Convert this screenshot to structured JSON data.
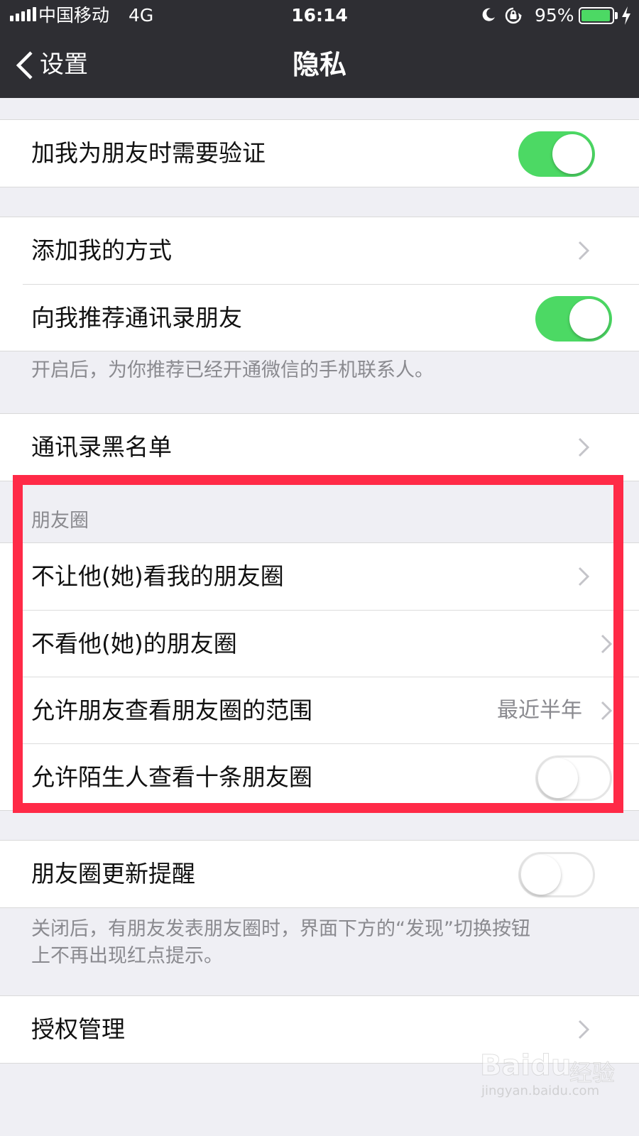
{
  "status_bar": {
    "carrier": "中国移动",
    "network": "4G",
    "time": "16:14",
    "battery_percent": "95%",
    "battery_level": 0.95,
    "battery_color": "#4cd964",
    "icons": [
      "signal-icon",
      "moon-icon",
      "rotation-lock-icon",
      "battery-icon",
      "charging-icon"
    ]
  },
  "nav": {
    "back_label": "设置",
    "title": "隐私"
  },
  "groups": {
    "g1": {
      "rows": [
        {
          "label": "加我为朋友时需要验证",
          "toggle": true
        }
      ]
    },
    "g2": {
      "rows": [
        {
          "label": "添加我的方式"
        },
        {
          "label": "向我推荐通讯录朋友",
          "toggle": true
        }
      ],
      "footer": "开启后，为你推荐已经开通微信的手机联系人。"
    },
    "g3": {
      "rows": [
        {
          "label": "通讯录黑名单"
        }
      ]
    },
    "moments": {
      "header": "朋友圈",
      "rows": [
        {
          "label": "不让他(她)看我的朋友圈"
        },
        {
          "label": "不看他(她)的朋友圈"
        },
        {
          "label": "允许朋友查看朋友圈的范围",
          "value": "最近半年"
        },
        {
          "label": "允许陌生人查看十条朋友圈",
          "toggle": false
        }
      ]
    },
    "g5": {
      "rows": [
        {
          "label": "朋友圈更新提醒",
          "toggle": false
        }
      ],
      "footer_line1": "关闭后，有朋友发表朋友圈时，界面下方的“发现”切换按钮",
      "footer_line2": "上不再出现红点提示。"
    },
    "g6": {
      "rows": [
        {
          "label": "授权管理"
        }
      ]
    }
  },
  "colors": {
    "toggle_on": "#4cd964",
    "highlight": "#ff2a47",
    "nav_bg": "#2e2e33"
  },
  "watermark": {
    "logo": "Baidu",
    "cn": "经验",
    "url": "jingyan.baidu.com"
  }
}
